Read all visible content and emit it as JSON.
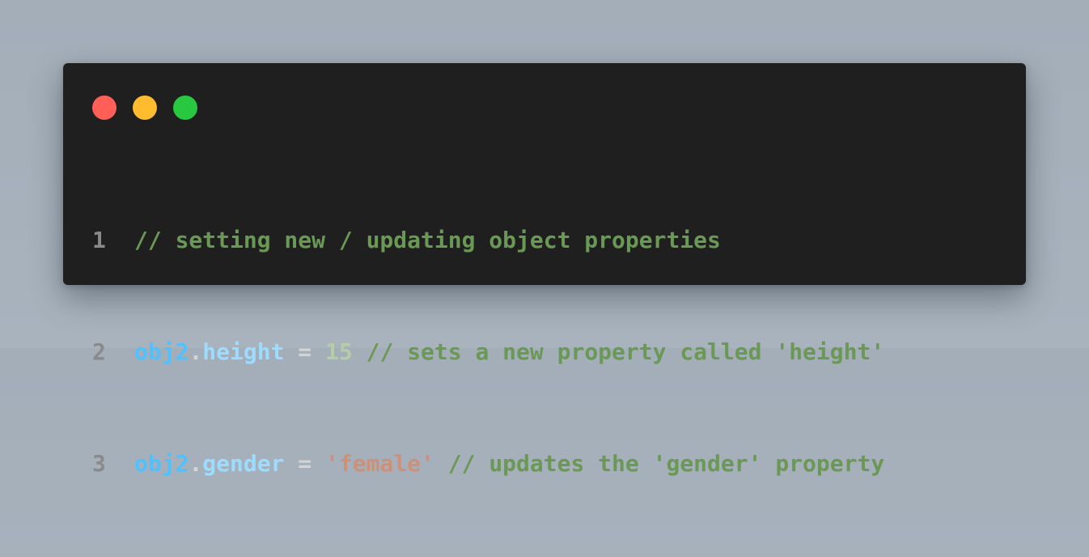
{
  "window": {
    "controls": {
      "close_color": "#ff5f57",
      "minimize_color": "#febc2e",
      "maximize_color": "#28c840"
    }
  },
  "code": {
    "lines": [
      {
        "number": "1",
        "comment": "// setting new / updating object properties"
      },
      {
        "number": "2",
        "object": "obj2",
        "dot": ".",
        "property": "height",
        "operator": " = ",
        "value": "15",
        "comment": " // sets a new property called 'height'"
      },
      {
        "number": "3",
        "object": "obj2",
        "dot": ".",
        "property": "gender",
        "operator": " = ",
        "value": "'female'",
        "comment": " // updates the 'gender' property"
      }
    ]
  }
}
